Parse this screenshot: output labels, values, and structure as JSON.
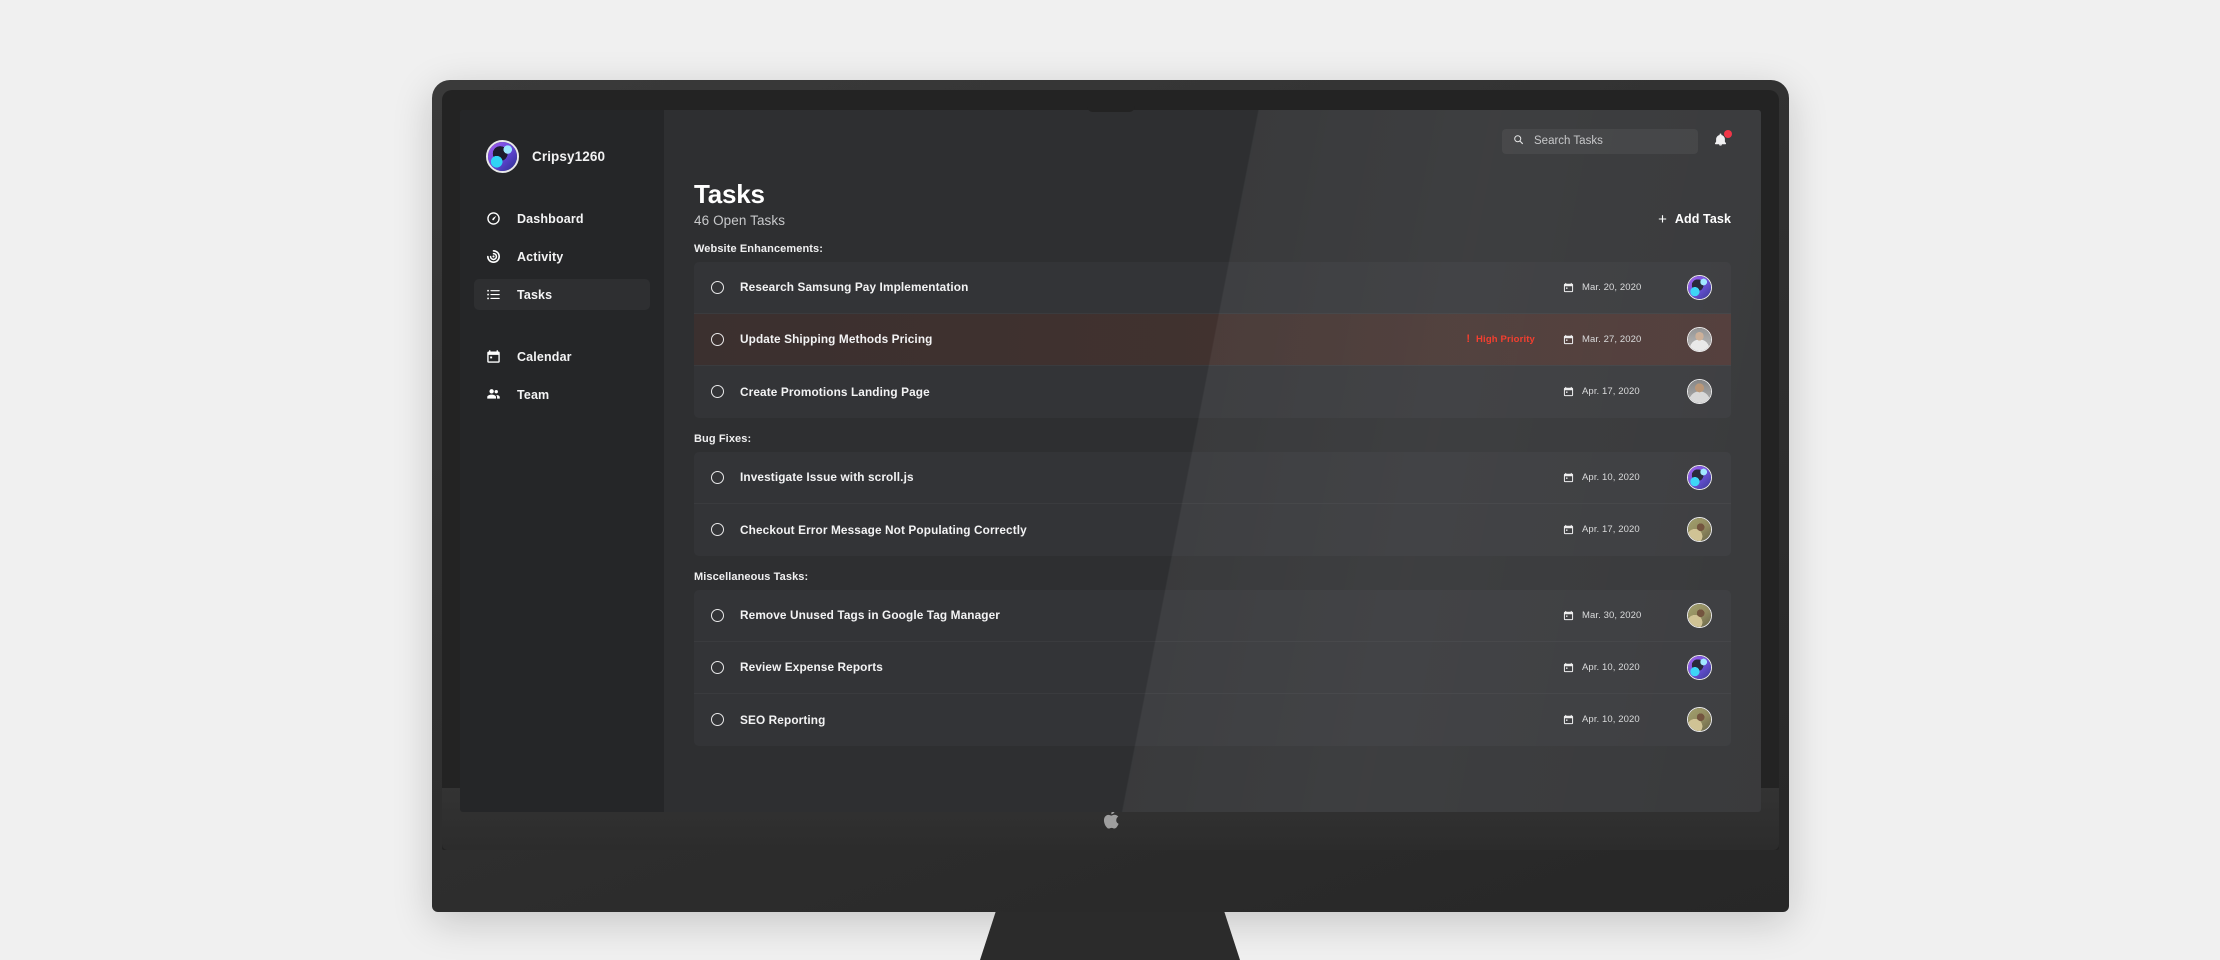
{
  "device": {
    "brand_logo": "apple-logo"
  },
  "sidebar": {
    "profile": {
      "name": "Cripsy1260",
      "avatar": "avatar-purple"
    },
    "items": [
      {
        "label": "Dashboard",
        "icon": "speedometer-icon",
        "active": false
      },
      {
        "label": "Activity",
        "icon": "pulse-icon",
        "active": false
      },
      {
        "label": "Tasks",
        "icon": "list-icon",
        "active": true
      },
      {
        "label": "Calendar",
        "icon": "calendar-icon",
        "active": false
      },
      {
        "label": "Team",
        "icon": "people-icon",
        "active": false
      }
    ]
  },
  "topbar": {
    "search": {
      "value": "",
      "placeholder": "Search Tasks",
      "icon": "search-icon"
    },
    "notifications": {
      "icon": "bell-icon",
      "has_badge": true,
      "badge_color": "#f0283c"
    }
  },
  "header": {
    "title": "Tasks",
    "subtitle": "46 Open Tasks",
    "add_button": {
      "label": "Add Task",
      "icon": "plus-icon"
    }
  },
  "colors": {
    "screen_bg": "#2e2f31",
    "sidebar_bg": "#252628",
    "card_bg": "#333437",
    "priority_red": "#f3301f",
    "priority_row_bg": "#42322f"
  },
  "groups": [
    {
      "title": "Website Enhancements:",
      "tasks": [
        {
          "title": "Research Samsung Pay Implementation",
          "date": "Mar. 20, 2020",
          "priority": null,
          "avatar": "avatar-purple",
          "checked": false
        },
        {
          "title": "Update Shipping Methods Pricing",
          "date": "Mar. 27, 2020",
          "priority": "High Priority",
          "avatar": "avatar-gray-1",
          "checked": false
        },
        {
          "title": "Create Promotions Landing Page",
          "date": "Apr. 17, 2020",
          "priority": null,
          "avatar": "avatar-gray-2",
          "checked": false
        }
      ]
    },
    {
      "title": "Bug Fixes:",
      "tasks": [
        {
          "title": "Investigate Issue with scroll.js",
          "date": "Apr. 10, 2020",
          "priority": null,
          "avatar": "avatar-purple",
          "checked": false
        },
        {
          "title": "Checkout Error Message Not Populating Correctly",
          "date": "Apr. 17, 2020",
          "priority": null,
          "avatar": "avatar-olive",
          "checked": false
        }
      ]
    },
    {
      "title": "Miscellaneous Tasks:",
      "tasks": [
        {
          "title": "Remove Unused Tags in Google Tag Manager",
          "date": "Mar. 30, 2020",
          "priority": null,
          "avatar": "avatar-olive",
          "checked": false
        },
        {
          "title": "Review Expense Reports",
          "date": "Apr. 10, 2020",
          "priority": null,
          "avatar": "avatar-purple",
          "checked": false
        },
        {
          "title": "SEO Reporting",
          "date": "Apr. 10, 2020",
          "priority": null,
          "avatar": "avatar-olive",
          "checked": false
        }
      ]
    }
  ]
}
